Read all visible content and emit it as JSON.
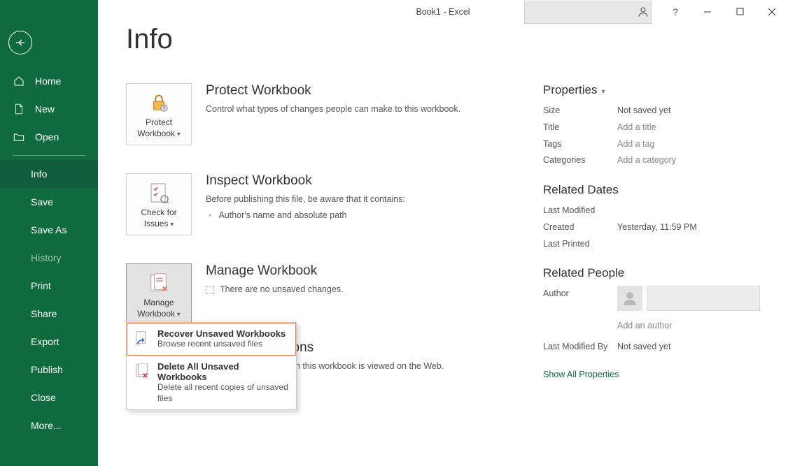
{
  "window": {
    "title": "Book1  -  Excel"
  },
  "sidebar": {
    "home": "Home",
    "new": "New",
    "open": "Open",
    "info": "Info",
    "save": "Save",
    "save_as": "Save As",
    "history": "History",
    "print": "Print",
    "share": "Share",
    "export": "Export",
    "publish": "Publish",
    "close": "Close",
    "more": "More..."
  },
  "page": {
    "title": "Info"
  },
  "sections": {
    "protect": {
      "button_line1": "Protect",
      "button_line2": "Workbook",
      "heading": "Protect Workbook",
      "desc": "Control what types of changes people can make to this workbook."
    },
    "inspect": {
      "button_line1": "Check for",
      "button_line2": "Issues",
      "heading": "Inspect Workbook",
      "desc": "Before publishing this file, be aware that it contains:",
      "item1": "Author's name and absolute path"
    },
    "manage": {
      "button_line1": "Manage",
      "button_line2": "Workbook",
      "heading": "Manage Workbook",
      "desc": "There are no unsaved changes.",
      "menu": {
        "recover_title": "Recover Unsaved Workbooks",
        "recover_sub": "Browse recent unsaved files",
        "delete_title": "Delete All Unsaved Workbooks",
        "delete_sub": "Delete all recent copies of unsaved files"
      }
    },
    "browser": {
      "heading_tail": "tions",
      "desc_tail": "hen this workbook is viewed on the Web."
    }
  },
  "properties": {
    "heading": "Properties",
    "rows": {
      "size_label": "Size",
      "size_value": "Not saved yet",
      "title_label": "Title",
      "title_value": "Add a title",
      "tags_label": "Tags",
      "tags_value": "Add a tag",
      "categories_label": "Categories",
      "categories_value": "Add a category"
    }
  },
  "related_dates": {
    "heading": "Related Dates",
    "last_modified_label": "Last Modified",
    "last_modified_value": "",
    "created_label": "Created",
    "created_value": "Yesterday, 11:59 PM",
    "last_printed_label": "Last Printed",
    "last_printed_value": ""
  },
  "related_people": {
    "heading": "Related People",
    "author_label": "Author",
    "add_author": "Add an author",
    "last_modified_by_label": "Last Modified By",
    "last_modified_by_value": "Not saved yet"
  },
  "show_all": "Show All Properties"
}
